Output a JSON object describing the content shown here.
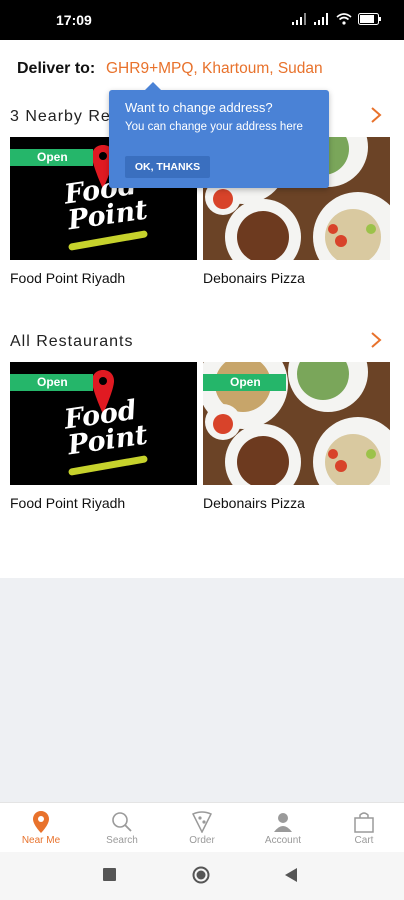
{
  "status_bar": {
    "time": "17:09",
    "battery": "85"
  },
  "deliver": {
    "label": "Deliver to:",
    "address": "GHR9+MPQ, Khartoum, Sudan"
  },
  "tooltip": {
    "title": "Want to change address?",
    "body": "You can change your address here",
    "button": "OK, THANKS"
  },
  "nearby": {
    "title": "3 Nearby Re",
    "restaurants": [
      {
        "name": "Food Point Riyadh",
        "badge": "Open",
        "logo_line1": "Food",
        "logo_line2": "Point"
      },
      {
        "name": "Debonairs Pizza",
        "badge": ""
      }
    ]
  },
  "all": {
    "title": "All Restaurants",
    "restaurants": [
      {
        "name": "Food Point Riyadh",
        "badge": "Open",
        "logo_line1": "Food",
        "logo_line2": "Point"
      },
      {
        "name": "Debonairs Pizza",
        "badge": "Open"
      }
    ]
  },
  "bottom_nav": [
    {
      "label": "Near Me",
      "icon": "location-pin-icon",
      "active": true
    },
    {
      "label": "Search",
      "icon": "search-icon",
      "active": false
    },
    {
      "label": "Order",
      "icon": "pizza-slice-icon",
      "active": false
    },
    {
      "label": "Account",
      "icon": "user-icon",
      "active": false
    },
    {
      "label": "Cart",
      "icon": "shopping-bag-icon",
      "active": false
    }
  ],
  "colors": {
    "accent": "#e8722c",
    "open_badge": "#25b66a",
    "tooltip": "#4a82d6"
  }
}
